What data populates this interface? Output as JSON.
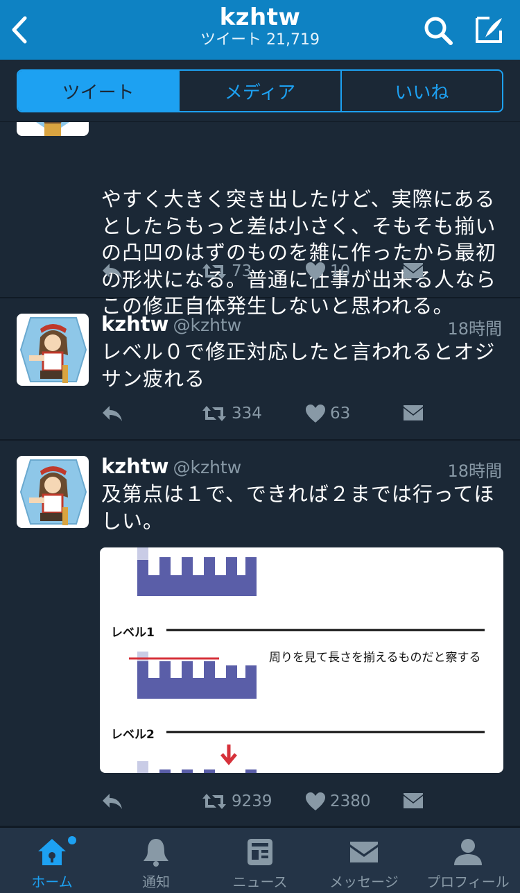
{
  "header": {
    "title": "kzhtw",
    "subtitle": "ツイート 21,719"
  },
  "segments": [
    {
      "label": "ツイート",
      "active": true
    },
    {
      "label": "メディア",
      "active": false
    },
    {
      "label": "いいね",
      "active": false
    }
  ],
  "tweets": [
    {
      "text": "やすく大きく突き出したけど、実際にあるとしたらもっと差は小さく、そもそも揃いの凸凹のはずのものを雑に作ったから最初の形状になる。普通に仕事が出来る人ならこの修正自体発生しないと思われる。",
      "retweets": "73",
      "likes": "10"
    },
    {
      "name": "kzhtw",
      "handle": "@kzhtw",
      "time": "18時間",
      "text": "レベル０で修正対応したと言われるとオジサン疲れる",
      "retweets": "334",
      "likes": "63"
    },
    {
      "name": "kzhtw",
      "handle": "@kzhtw",
      "time": "18時間",
      "text": "及第点は１で、できれば２までは行ってほしい。",
      "retweets": "9239",
      "likes": "2380",
      "media": {
        "level1": "レベル1",
        "note": "周りを見て長さを揃えるものだと察する",
        "level2": "レベル2"
      }
    }
  ],
  "tabbar": [
    {
      "label": "ホーム",
      "icon": "home-icon",
      "active": true
    },
    {
      "label": "通知",
      "icon": "bell-icon",
      "active": false
    },
    {
      "label": "ニュース",
      "icon": "news-icon",
      "active": false
    },
    {
      "label": "メッセージ",
      "icon": "envelope-icon",
      "active": false
    },
    {
      "label": "プロフィール",
      "icon": "person-icon",
      "active": false
    }
  ],
  "colors": {
    "header": "#0e82c3",
    "background": "#1b2836",
    "accent": "#1da1f2",
    "muted": "#8899a6"
  }
}
